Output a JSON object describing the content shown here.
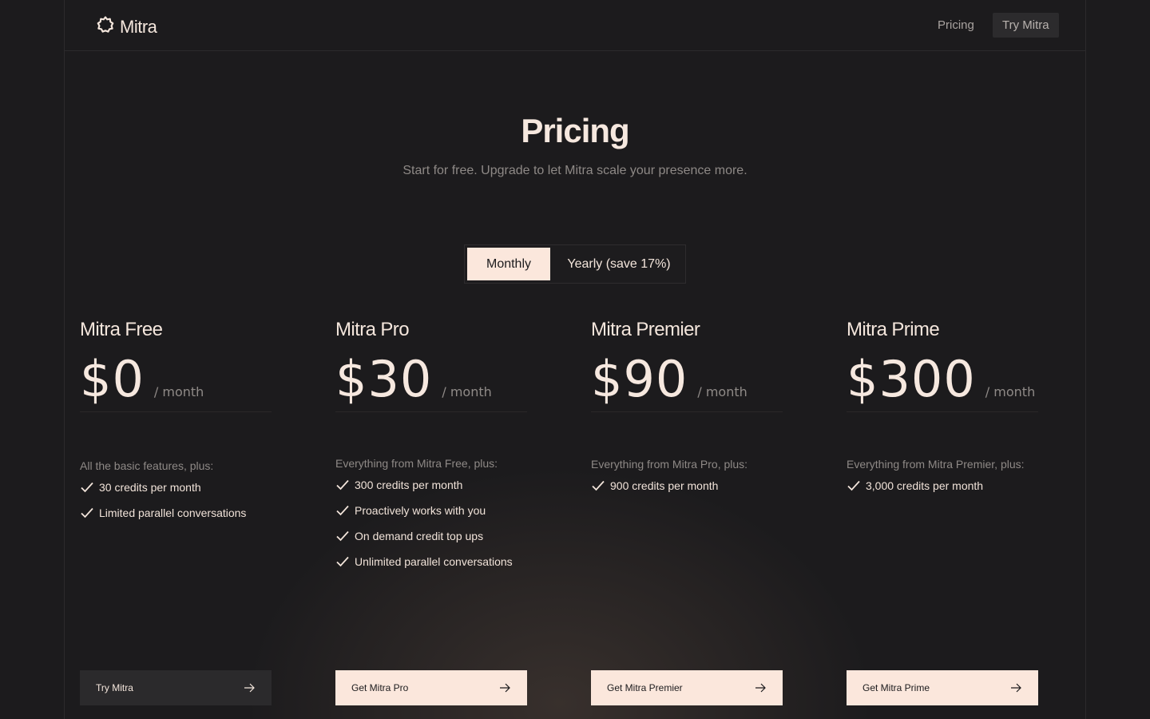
{
  "brand": {
    "name": "Mitra",
    "logo_icon": "gear-sun-icon"
  },
  "nav": {
    "pricing": "Pricing",
    "try": "Try Mitra"
  },
  "hero": {
    "title": "Pricing",
    "subtitle": "Start for free. Upgrade to let Mitra scale your presence more."
  },
  "billing_toggle": {
    "monthly": "Monthly",
    "yearly": "Yearly (save 17%)",
    "selected": "Monthly"
  },
  "plans": [
    {
      "name": "Mitra Free",
      "price": "$0",
      "period": "/ month",
      "intro": "All the basic features, plus:",
      "features": [
        "30 credits per month",
        "Limited parallel conversations"
      ],
      "cta": "Try Mitra",
      "cta_style": "dark"
    },
    {
      "name": "Mitra Pro",
      "price": "$30",
      "period": "/ month",
      "intro": "Everything from Mitra Free, plus:",
      "features": [
        "300 credits per month",
        "Proactively works with you",
        "On demand credit top ups",
        "Unlimited parallel conversations"
      ],
      "cta": "Get Mitra Pro",
      "cta_style": "light"
    },
    {
      "name": "Mitra Premier",
      "price": "$90",
      "period": "/ month",
      "intro": "Everything from Mitra Pro, plus:",
      "features": [
        "900 credits per month"
      ],
      "cta": "Get Mitra Premier",
      "cta_style": "light"
    },
    {
      "name": "Mitra Prime",
      "price": "$300",
      "period": "/ month",
      "intro": "Everything from Mitra Premier, plus:",
      "features": [
        "3,000 credits per month"
      ],
      "cta": "Get Mitra Prime",
      "cta_style": "light"
    }
  ],
  "icons": {
    "feature_check": "check-icon",
    "cta_arrow": "arrow-right-icon"
  },
  "colors": {
    "background": "#1c1b1d",
    "accent": "#fbe7dc",
    "text": "#f4e6dc",
    "muted": "#8e8986"
  }
}
